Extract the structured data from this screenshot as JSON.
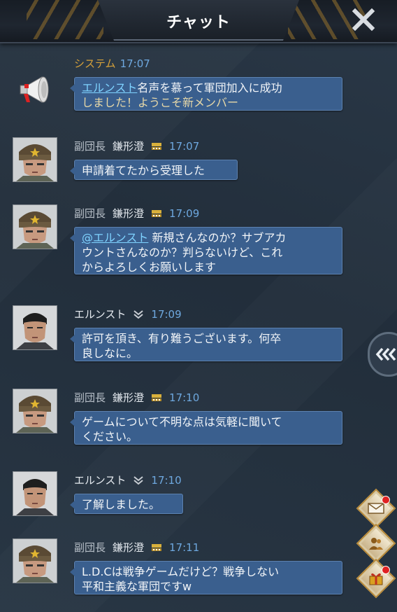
{
  "header": {
    "title": "チャット"
  },
  "system_message": {
    "sender": "システム",
    "time": "17:07",
    "mention": "エルンスト",
    "line1_rest": "名声を慕って軍団加入に成功",
    "line2": "しました！ようこそ新メンバー"
  },
  "messages": [
    {
      "role": "副団長",
      "name": "鎌形澄",
      "time": "17:07",
      "lines": [
        "申請着てたから受理した"
      ]
    },
    {
      "role": "副団長",
      "name": "鎌形澄",
      "time": "17:09",
      "mention": "@エルンスト",
      "line1_rest": " 新規さんなのか？サブアカ",
      "lines": [
        "ウントさんなのか？判らないけど、これ",
        "からよろしくお願いします"
      ]
    },
    {
      "role": "",
      "name": "エルンスト",
      "time": "17:09",
      "lines": [
        "許可を頂き、有り難うございます。何卒",
        "良しなに。"
      ]
    },
    {
      "role": "副団長",
      "name": "鎌形澄",
      "time": "17:10",
      "lines": [
        "ゲームについて不明な点は気軽に聞いて",
        "ください。"
      ]
    },
    {
      "role": "",
      "name": "エルンスト",
      "time": "17:10",
      "lines": [
        "了解しました。"
      ]
    },
    {
      "role": "副団長",
      "name": "鎌形澄",
      "time": "17:11",
      "lines": [
        "L.D.Cは戦争ゲームだけど？戦争しない",
        "平和主義な軍団ですw"
      ]
    }
  ],
  "colors": {
    "bubble": "#3a5f8e",
    "time": "#6ea8df",
    "system": "#d7a23a",
    "mention": "#7fd3ff"
  },
  "icons": {
    "close": "close-icon",
    "announce": "megaphone-icon",
    "rank_officer": "rank-badge-icon",
    "rank_member": "chevron-rank-icon",
    "side": "chevrons-left-icon",
    "mail": "mail-icon",
    "members": "members-icon",
    "gift": "gift-icon"
  }
}
